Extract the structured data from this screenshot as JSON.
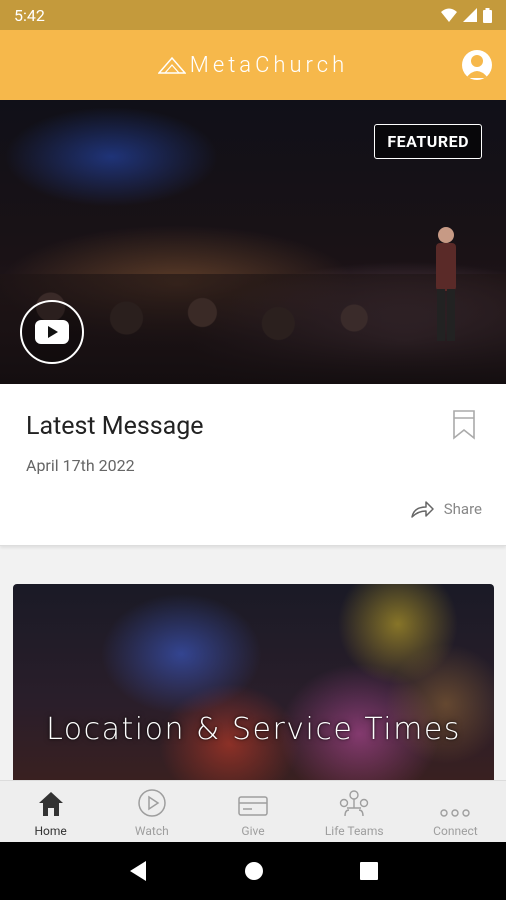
{
  "status_bar": {
    "time": "5:42"
  },
  "app_bar": {
    "logo_text": "MetaChurch"
  },
  "featured": {
    "badge": "FEATURED"
  },
  "message": {
    "title": "Latest Message",
    "date": "April 17th 2022",
    "share_label": "Share"
  },
  "location": {
    "title": "Location & Service Times"
  },
  "bottom_nav": {
    "items": [
      {
        "label": "Home",
        "icon": "home-icon",
        "active": true
      },
      {
        "label": "Watch",
        "icon": "play-circle-icon",
        "active": false
      },
      {
        "label": "Give",
        "icon": "card-icon",
        "active": false
      },
      {
        "label": "Life Teams",
        "icon": "group-icon",
        "active": false
      },
      {
        "label": "Connect",
        "icon": "more-icon",
        "active": false
      }
    ]
  },
  "colors": {
    "status_bar": "#c49a3c",
    "app_bar": "#f6b84b",
    "active_nav": "#333333",
    "inactive_nav": "#9e9e9e"
  }
}
